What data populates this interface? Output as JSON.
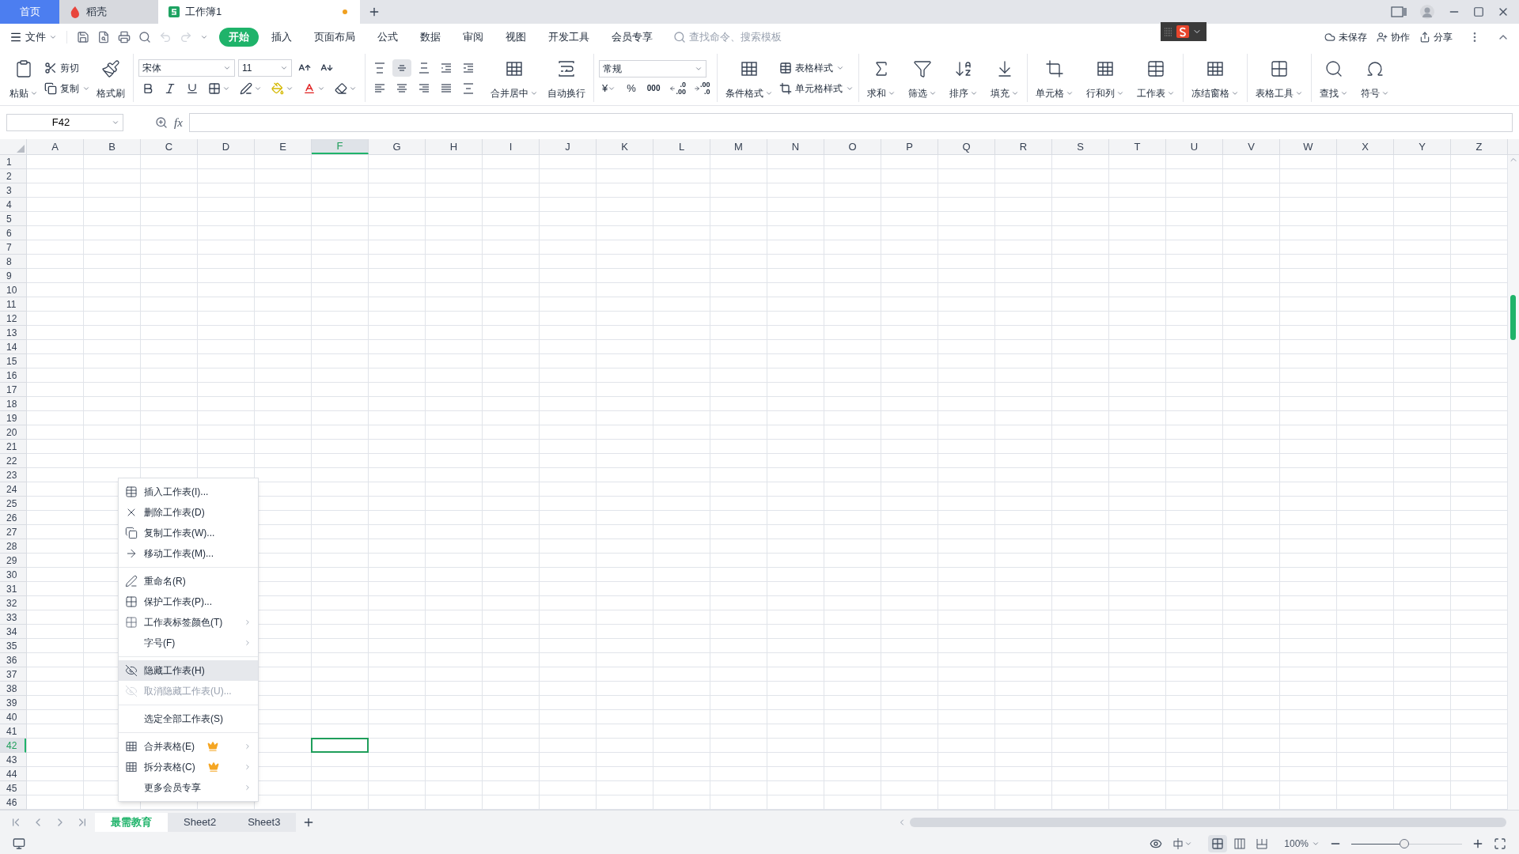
{
  "title_tabs": [
    {
      "label": "首页",
      "kind": "home",
      "selected": false
    },
    {
      "label": "稻壳",
      "kind": "docer",
      "selected": false
    },
    {
      "label": "工作簿1",
      "kind": "sheet",
      "selected": true,
      "unsaved": true
    }
  ],
  "menu": {
    "file": "文件",
    "tabs": [
      {
        "label": "开始",
        "selected": true
      },
      {
        "label": "插入",
        "selected": false
      },
      {
        "label": "页面布局",
        "selected": false
      },
      {
        "label": "公式",
        "selected": false
      },
      {
        "label": "数据",
        "selected": false
      },
      {
        "label": "审阅",
        "selected": false
      },
      {
        "label": "视图",
        "selected": false
      },
      {
        "label": "开发工具",
        "selected": false
      },
      {
        "label": "会员专享",
        "selected": false
      }
    ],
    "search_placeholder": "查找命令、搜索模板",
    "actions": [
      "未保存",
      "协作",
      "分享"
    ]
  },
  "ribbon": {
    "paste": "粘贴",
    "cut": "剪切",
    "copy": "复制",
    "format_painter": "格式刷",
    "font_name": "宋体",
    "font_size": "11",
    "merge": "合并居中",
    "wrap": "自动换行",
    "number_format": "常规",
    "currency": "¥",
    "percent": "%",
    "thousands": "000",
    "decimals": [
      {
        "top": ".0",
        "bottom": ".00"
      },
      {
        "top": ".00",
        "bottom": ".0"
      }
    ],
    "conditional_format": "条件格式",
    "table_style": "表格样式",
    "cell_style": "单元格样式",
    "tool_groups": [
      [
        "求和",
        "筛选",
        "排序",
        "填充"
      ],
      [
        "单元格",
        "行和列",
        "工作表"
      ],
      [
        "冻结窗格"
      ],
      [
        "表格工具"
      ],
      [
        "查找",
        "符号"
      ]
    ]
  },
  "formula_bar": {
    "name_box": "F42",
    "function_label": "fx"
  },
  "columns": [
    {
      "label": "A",
      "selected": false
    },
    {
      "label": "B",
      "selected": false
    },
    {
      "label": "C",
      "selected": false
    },
    {
      "label": "D",
      "selected": false
    },
    {
      "label": "E",
      "selected": false
    },
    {
      "label": "F",
      "selected": true
    },
    {
      "label": "G",
      "selected": false
    },
    {
      "label": "H",
      "selected": false
    },
    {
      "label": "I",
      "selected": false
    },
    {
      "label": "J",
      "selected": false
    },
    {
      "label": "K",
      "selected": false
    },
    {
      "label": "L",
      "selected": false
    },
    {
      "label": "M",
      "selected": false
    },
    {
      "label": "N",
      "selected": false
    },
    {
      "label": "O",
      "selected": false
    },
    {
      "label": "P",
      "selected": false
    },
    {
      "label": "Q",
      "selected": false
    },
    {
      "label": "R",
      "selected": false
    },
    {
      "label": "S",
      "selected": false
    },
    {
      "label": "T",
      "selected": false
    },
    {
      "label": "U",
      "selected": false
    },
    {
      "label": "V",
      "selected": false
    },
    {
      "label": "W",
      "selected": false
    },
    {
      "label": "X",
      "selected": false
    },
    {
      "label": "Y",
      "selected": false
    },
    {
      "label": "Z",
      "selected": false
    }
  ],
  "rows": [
    {
      "label": "1",
      "selected": false
    },
    {
      "label": "2",
      "selected": false
    },
    {
      "label": "3",
      "selected": false
    },
    {
      "label": "4",
      "selected": false
    },
    {
      "label": "5",
      "selected": false
    },
    {
      "label": "6",
      "selected": false
    },
    {
      "label": "7",
      "selected": false
    },
    {
      "label": "8",
      "selected": false
    },
    {
      "label": "9",
      "selected": false
    },
    {
      "label": "10",
      "selected": false
    },
    {
      "label": "11",
      "selected": false
    },
    {
      "label": "12",
      "selected": false
    },
    {
      "label": "13",
      "selected": false
    },
    {
      "label": "14",
      "selected": false
    },
    {
      "label": "15",
      "selected": false
    },
    {
      "label": "16",
      "selected": false
    },
    {
      "label": "17",
      "selected": false
    },
    {
      "label": "18",
      "selected": false
    },
    {
      "label": "19",
      "selected": false
    },
    {
      "label": "20",
      "selected": false
    },
    {
      "label": "21",
      "selected": false
    },
    {
      "label": "22",
      "selected": false
    },
    {
      "label": "23",
      "selected": false
    },
    {
      "label": "24",
      "selected": false
    },
    {
      "label": "25",
      "selected": false
    },
    {
      "label": "26",
      "selected": false
    },
    {
      "label": "27",
      "selected": false
    },
    {
      "label": "28",
      "selected": false
    },
    {
      "label": "29",
      "selected": false
    },
    {
      "label": "30",
      "selected": false
    },
    {
      "label": "31",
      "selected": false
    },
    {
      "label": "32",
      "selected": false
    },
    {
      "label": "33",
      "selected": false
    },
    {
      "label": "34",
      "selected": false
    },
    {
      "label": "35",
      "selected": false
    },
    {
      "label": "36",
      "selected": false
    },
    {
      "label": "37",
      "selected": false
    },
    {
      "label": "38",
      "selected": false
    },
    {
      "label": "39",
      "selected": false
    },
    {
      "label": "40",
      "selected": false
    },
    {
      "label": "41",
      "selected": false
    },
    {
      "label": "42",
      "selected": true
    },
    {
      "label": "43",
      "selected": false
    },
    {
      "label": "44",
      "selected": false
    },
    {
      "label": "45",
      "selected": false
    },
    {
      "label": "46",
      "selected": false
    }
  ],
  "context_menu": {
    "groups": [
      [
        {
          "label": "插入工作表(I)...",
          "selected": false,
          "disabled": false,
          "submenu": false,
          "premium": false
        },
        {
          "label": "删除工作表(D)",
          "selected": false,
          "disabled": false,
          "submenu": false,
          "premium": false
        },
        {
          "label": "复制工作表(W)...",
          "selected": false,
          "disabled": false,
          "submenu": false,
          "premium": false
        },
        {
          "label": "移动工作表(M)...",
          "selected": false,
          "disabled": false,
          "submenu": false,
          "premium": false
        }
      ],
      [
        {
          "label": "重命名(R)",
          "selected": false,
          "disabled": false,
          "submenu": false,
          "premium": false
        },
        {
          "label": "保护工作表(P)...",
          "selected": false,
          "disabled": false,
          "submenu": false,
          "premium": false
        },
        {
          "label": "工作表标签颜色(T)",
          "selected": false,
          "disabled": false,
          "submenu": true,
          "premium": false
        },
        {
          "label": "字号(F)",
          "selected": false,
          "disabled": false,
          "submenu": true,
          "premium": false
        }
      ],
      [
        {
          "label": "隐藏工作表(H)",
          "selected": true,
          "disabled": false,
          "submenu": false,
          "premium": false
        },
        {
          "label": "取消隐藏工作表(U)...",
          "selected": false,
          "disabled": true,
          "submenu": false,
          "premium": false
        }
      ],
      [
        {
          "label": "选定全部工作表(S)",
          "selected": false,
          "disabled": false,
          "submenu": false,
          "premium": false
        }
      ],
      [
        {
          "label": "合并表格(E)",
          "selected": false,
          "disabled": false,
          "submenu": true,
          "premium": true
        },
        {
          "label": "拆分表格(C)",
          "selected": false,
          "disabled": false,
          "submenu": true,
          "premium": true
        },
        {
          "label": "更多会员专享",
          "selected": false,
          "disabled": false,
          "submenu": true,
          "premium": false
        }
      ]
    ]
  },
  "sheet_tabs": [
    {
      "label": "最需教育",
      "selected": true
    },
    {
      "label": "Sheet2",
      "selected": false
    },
    {
      "label": "Sheet3",
      "selected": false
    }
  ],
  "status_bar": {
    "view_modes": [
      {
        "selected": true
      },
      {
        "selected": false
      },
      {
        "selected": false
      }
    ],
    "zoom": {
      "label": "100%",
      "level": 0.48
    }
  }
}
